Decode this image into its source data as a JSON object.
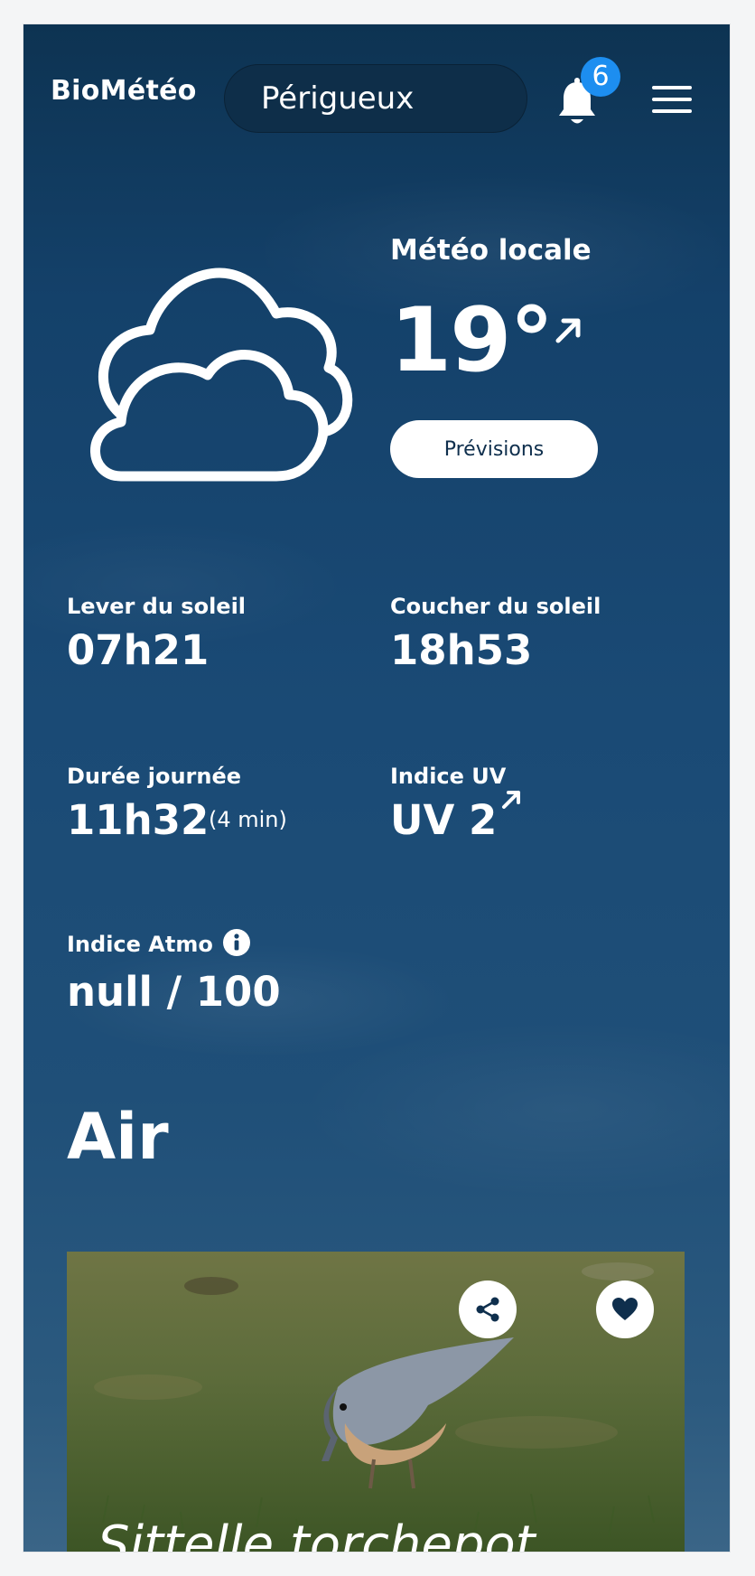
{
  "header": {
    "logo": "BioMétéo",
    "city": "Périgueux",
    "notifications_count": "6"
  },
  "hero": {
    "label": "Météo locale",
    "temperature": "19°",
    "forecast_button": "Prévisions",
    "weather_icon": "cloud-icon"
  },
  "stats": {
    "sunrise_label": "Lever du soleil",
    "sunrise_value": "07h21",
    "sunset_label": "Coucher du soleil",
    "sunset_value": "18h53",
    "daylength_label": "Durée journée",
    "daylength_value": "11h32",
    "daylength_delta": "(4 min)",
    "uv_label": "Indice UV",
    "uv_value": "UV 2",
    "atmo_label": "Indice Atmo",
    "atmo_value": "null / 100"
  },
  "section": {
    "title": "Air"
  },
  "card": {
    "title": "Sittelle torchepot",
    "share_icon": "share-icon",
    "favorite_icon": "heart-icon"
  },
  "colors": {
    "background_top": "#0d3352",
    "background_bottom": "#3a6587",
    "city_pill": "#0e2e49",
    "badge": "#1d8ef0",
    "button_text": "#0f2f4d"
  }
}
